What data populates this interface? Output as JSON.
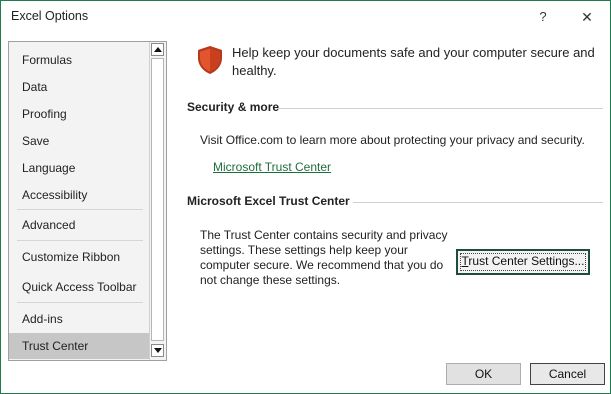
{
  "window": {
    "title": "Excel Options",
    "help_label": "?",
    "close_label": "✕"
  },
  "sidebar": {
    "items": [
      {
        "label": "Formulas"
      },
      {
        "label": "Data"
      },
      {
        "label": "Proofing"
      },
      {
        "label": "Save"
      },
      {
        "label": "Language"
      },
      {
        "label": "Accessibility"
      },
      {
        "label": "Advanced"
      },
      {
        "label": "Customize Ribbon"
      },
      {
        "label": "Quick Access Toolbar"
      },
      {
        "label": "Add-ins"
      },
      {
        "label": "Trust Center"
      }
    ],
    "selected": "Trust Center"
  },
  "main": {
    "headline": "Help keep your documents safe and your computer secure and healthy.",
    "security_section": {
      "heading": "Security & more",
      "text": "Visit Office.com to learn more about protecting your privacy and security.",
      "link": "Microsoft Trust Center"
    },
    "trust_center_section": {
      "heading": "Microsoft Excel Trust Center",
      "text": "The Trust Center contains security and privacy settings. These settings help keep your computer secure. We recommend that you do not change these settings.",
      "button_mnemonic": "T",
      "button_rest": "rust Center Settings..."
    }
  },
  "footer": {
    "ok_label": "OK",
    "cancel_label": "Cancel"
  },
  "colors": {
    "accent": "#1e6e3c",
    "shield": "#d24726",
    "selected_bg": "#c6c6c6"
  }
}
